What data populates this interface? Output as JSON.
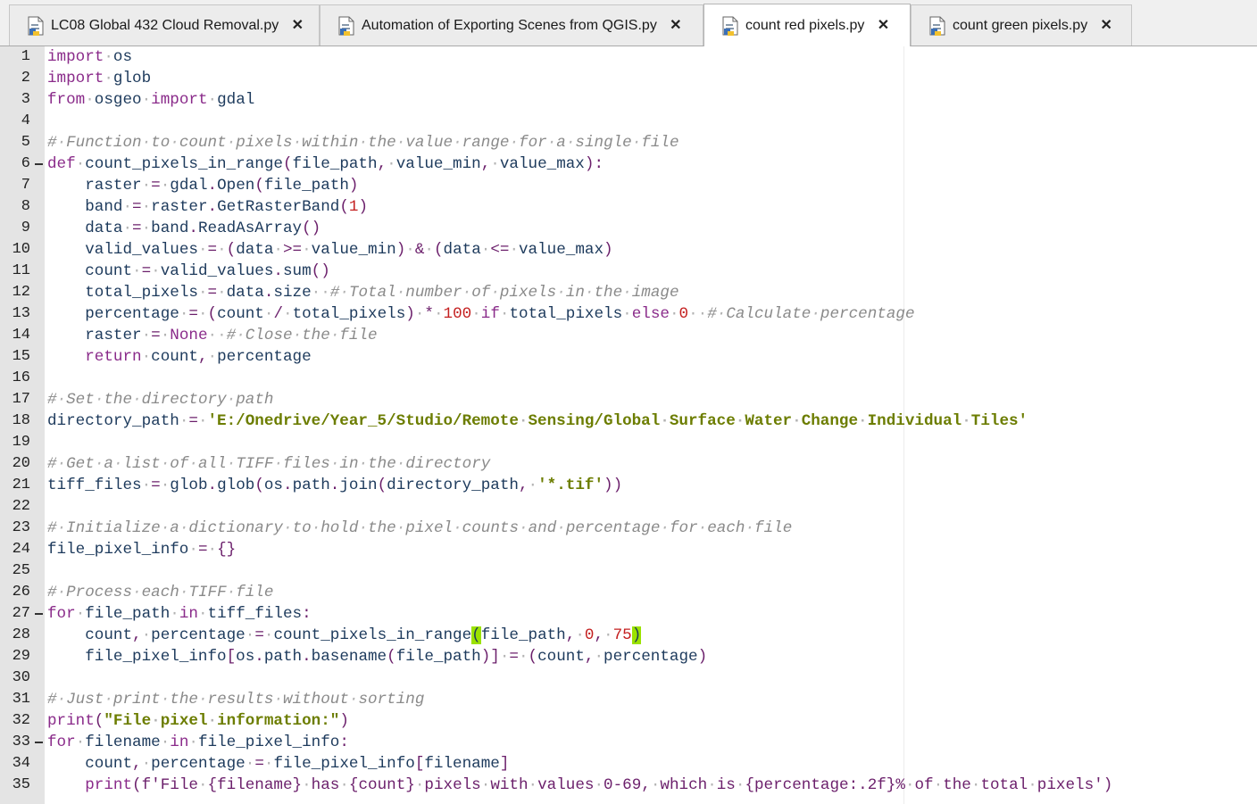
{
  "tabs": [
    {
      "label": "LC08 Global 432 Cloud Removal.py",
      "active": false
    },
    {
      "label": "Automation of Exporting Scenes from QGIS.py",
      "active": false
    },
    {
      "label": "count red pixels.py",
      "active": true
    },
    {
      "label": "count green pixels.py",
      "active": false
    }
  ],
  "tab_close_glyph": "✕",
  "colors": {
    "keyword": "#8a2b8a",
    "identifier": "#1d3a5c",
    "number": "#c41f1f",
    "string": "#6c7d00",
    "comment": "#8a8a8a",
    "brace_match": "#9be200",
    "gutter": "#e4e4e4"
  },
  "fold_lines": [
    6,
    27,
    33
  ],
  "code_lines": [
    "import os",
    "import glob",
    "from osgeo import gdal",
    "",
    "# Function to count pixels within the value range for a single file",
    "def count_pixels_in_range(file_path, value_min, value_max):",
    "    raster = gdal.Open(file_path)",
    "    band = raster.GetRasterBand(1)",
    "    data = band.ReadAsArray()",
    "    valid_values = (data >= value_min) & (data <= value_max)",
    "    count = valid_values.sum()",
    "    total_pixels = data.size  # Total number of pixels in the image",
    "    percentage = (count / total_pixels) * 100 if total_pixels else 0  # Calculate percentage",
    "    raster = None  # Close the file",
    "    return count, percentage",
    "",
    "# Set the directory path",
    "directory_path = 'E:/Onedrive/Year_5/Studio/Remote Sensing/Global Surface Water Change Individual Tiles'",
    "",
    "# Get a list of all TIFF files in the directory",
    "tiff_files = glob.glob(os.path.join(directory_path, '*.tif'))",
    "",
    "# Initialize a dictionary to hold the pixel counts and percentage for each file",
    "file_pixel_info = {}",
    "",
    "# Process each TIFF file",
    "for file_path in tiff_files:",
    "    count, percentage = count_pixels_in_range(file_path, 0, 75)",
    "    file_pixel_info[os.path.basename(file_path)] = (count, percentage)",
    "",
    "# Just print the results without sorting",
    "print(\"File pixel information:\")",
    "for filename in file_pixel_info:",
    "    count, percentage = file_pixel_info[filename]",
    "    print(f'File {filename} has {count} pixels with values 0-69, which is {percentage:.2f}% of the total pixels')"
  ]
}
